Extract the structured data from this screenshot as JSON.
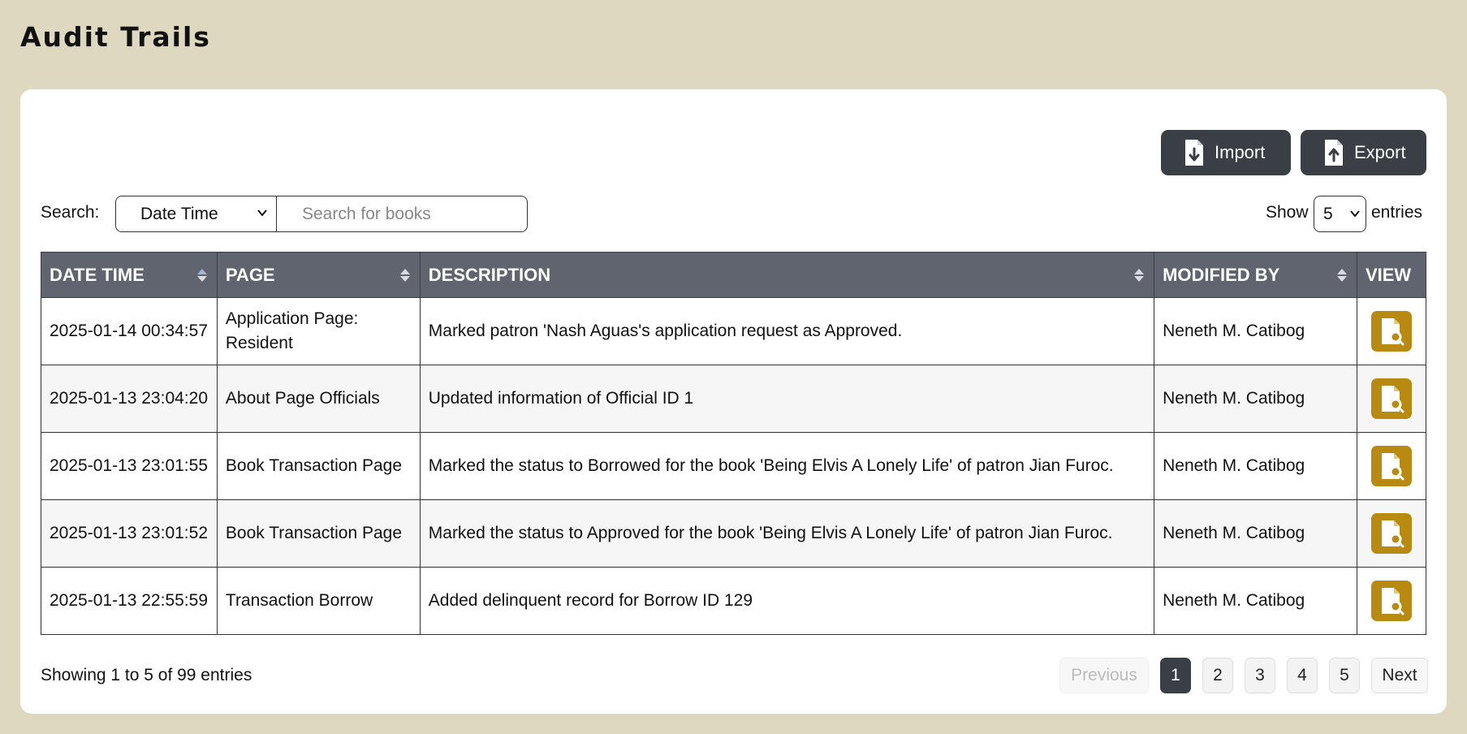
{
  "page_title": "Audit Trails",
  "toolbar": {
    "import_label": "Import",
    "export_label": "Export"
  },
  "search": {
    "label": "Search:",
    "field_selected": "Date Time",
    "placeholder": "Search for books",
    "value": ""
  },
  "length": {
    "show_label": "Show",
    "selected": "5",
    "entries_label": "entries"
  },
  "table": {
    "headers": {
      "date_time": "DATE TIME",
      "page": "PAGE",
      "description": "DESCRIPTION",
      "modified_by": "MODIFIED BY",
      "view": "VIEW"
    },
    "rows": [
      {
        "date_time": "2025-01-14 00:34:57",
        "page": "Application Page: Resident",
        "description": "Marked patron 'Nash Aguas's application request as Approved.",
        "modified_by": "Neneth M. Catibog"
      },
      {
        "date_time": "2025-01-13 23:04:20",
        "page": "About Page Officials",
        "description": "Updated information of Official ID 1",
        "modified_by": "Neneth M. Catibog"
      },
      {
        "date_time": "2025-01-13 23:01:55",
        "page": "Book Transaction Page",
        "description": "Marked the status to Borrowed for the book 'Being Elvis A Lonely Life' of patron Jian Furoc.",
        "modified_by": "Neneth M. Catibog"
      },
      {
        "date_time": "2025-01-13 23:01:52",
        "page": "Book Transaction Page",
        "description": "Marked the status to Approved for the book 'Being Elvis A Lonely Life' of patron Jian Furoc.",
        "modified_by": "Neneth M. Catibog"
      },
      {
        "date_time": "2025-01-13 22:55:59",
        "page": "Transaction Borrow",
        "description": "Added delinquent record for Borrow ID 129",
        "modified_by": "Neneth M. Catibog"
      }
    ]
  },
  "footer": {
    "info": "Showing 1 to 5 of 99 entries",
    "previous_label": "Previous",
    "pages": [
      "1",
      "2",
      "3",
      "4",
      "5"
    ],
    "active_page": "1",
    "next_label": "Next"
  },
  "colors": {
    "background": "#dfd8c1",
    "button_dark": "#3a3e45",
    "table_header": "#5f646e",
    "view_button": "#b88a12"
  },
  "icons": {
    "import": "file-download-icon",
    "export": "file-upload-icon",
    "view": "file-search-icon",
    "sort": "sort-icon",
    "select": "chevron-down-icon"
  }
}
